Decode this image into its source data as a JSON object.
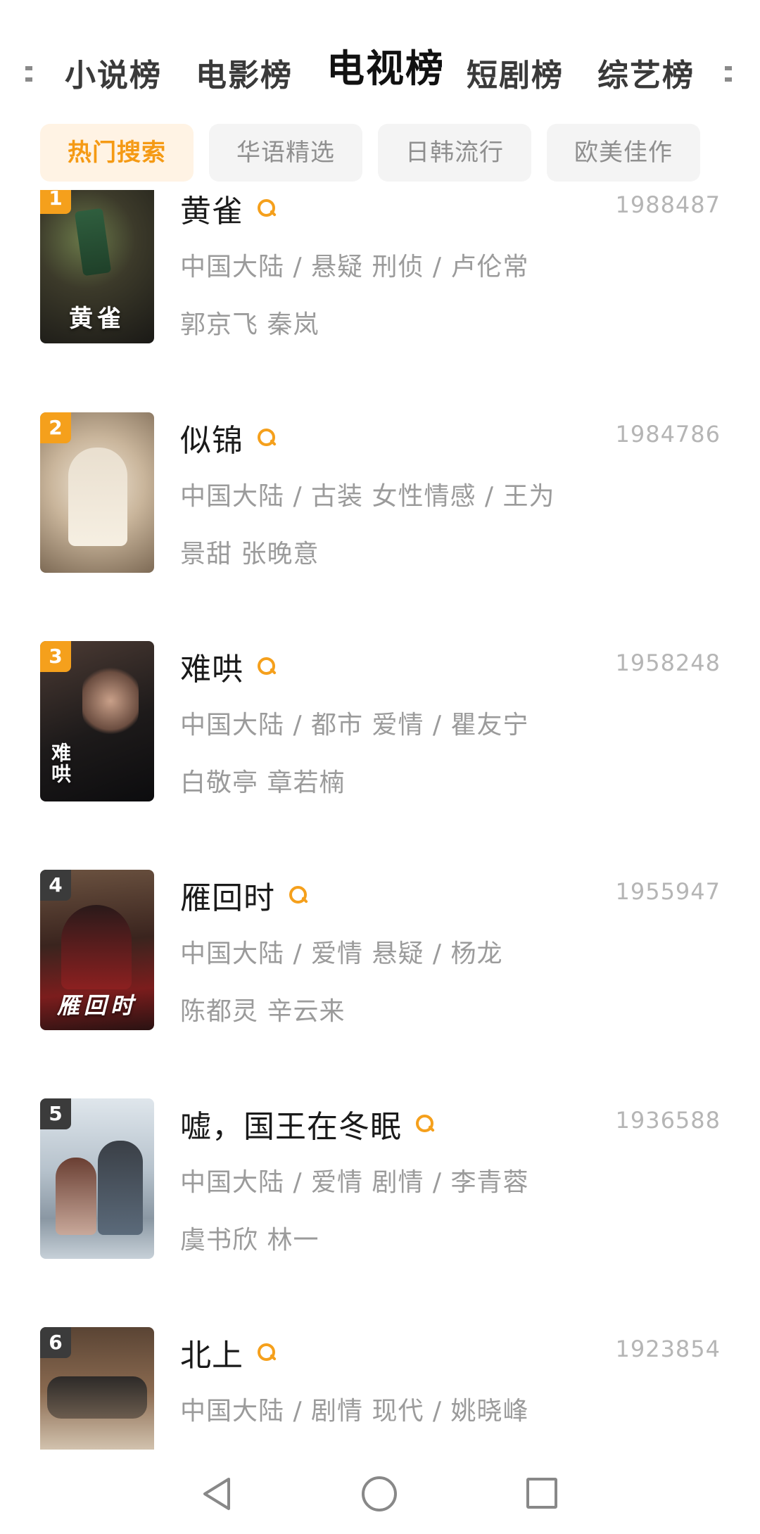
{
  "tabs": {
    "items": [
      {
        "label": "小说榜",
        "active": false
      },
      {
        "label": "电影榜",
        "active": false
      },
      {
        "label": "电视榜",
        "active": true
      },
      {
        "label": "短剧榜",
        "active": false
      },
      {
        "label": "综艺榜",
        "active": false
      }
    ]
  },
  "chips": [
    {
      "label": "热门搜索",
      "active": true
    },
    {
      "label": "华语精选",
      "active": false
    },
    {
      "label": "日韩流行",
      "active": false
    },
    {
      "label": "欧美佳作",
      "active": false
    }
  ],
  "list": {
    "items": [
      {
        "rank": "1",
        "title": "黄雀",
        "count": "1988487",
        "meta": "中国大陆 / 悬疑 刑侦 / 卢伦常",
        "cast": "郭京飞 秦岚",
        "poster_text": "黄雀"
      },
      {
        "rank": "2",
        "title": "似锦",
        "count": "1984786",
        "meta": "中国大陆 / 古装 女性情感 / 王为",
        "cast": "景甜 张晚意",
        "poster_text": ""
      },
      {
        "rank": "3",
        "title": "难哄",
        "count": "1958248",
        "meta": "中国大陆 / 都市 爱情 / 瞿友宁",
        "cast": "白敬亭 章若楠",
        "poster_text": "难哄"
      },
      {
        "rank": "4",
        "title": "雁回时",
        "count": "1955947",
        "meta": "中国大陆 / 爱情 悬疑 / 杨龙",
        "cast": "陈都灵 辛云来",
        "poster_text": "雁回时"
      },
      {
        "rank": "5",
        "title": "嘘，国王在冬眠",
        "count": "1936588",
        "meta": "中国大陆 / 爱情 剧情 / 李青蓉",
        "cast": "虞书欣 林一",
        "poster_text": ""
      },
      {
        "rank": "6",
        "title": "北上",
        "count": "1923854",
        "meta": "中国大陆 / 剧情 现代 / 姚晓峰",
        "cast": "",
        "poster_text": ""
      }
    ]
  },
  "colors": {
    "accent": "#f5a01c",
    "chip_active_bg": "#fff3e4",
    "text_primary": "#1a1a1a",
    "text_secondary": "#9b9b9b"
  },
  "icons": {
    "title_search": "search-icon",
    "nav_back": "back-triangle-icon",
    "nav_home": "home-circle-icon",
    "nav_recent": "recent-apps-square-icon"
  }
}
